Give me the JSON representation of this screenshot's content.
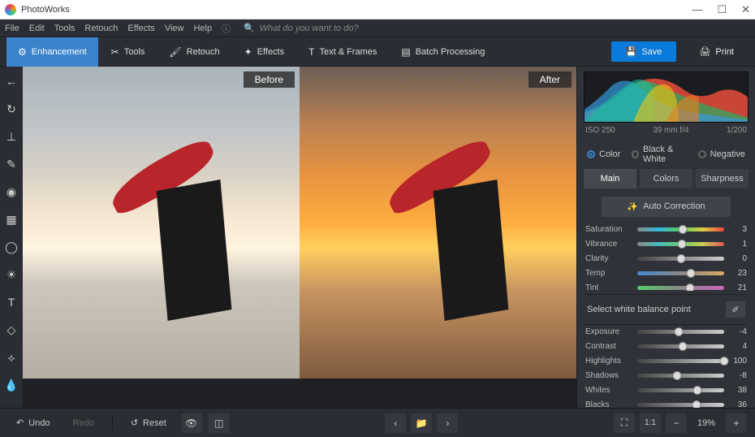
{
  "app": {
    "title": "PhotoWorks"
  },
  "window_controls": {
    "min": "—",
    "max": "☐",
    "close": "✕"
  },
  "menu": [
    "File",
    "Edit",
    "Tools",
    "Retouch",
    "Effects",
    "View",
    "Help"
  ],
  "search": {
    "placeholder": "What do you want to do?"
  },
  "tabs": [
    {
      "label": "Enhancement",
      "icon": "sliders-icon"
    },
    {
      "label": "Tools",
      "icon": "crop-icon"
    },
    {
      "label": "Retouch",
      "icon": "brush-icon"
    },
    {
      "label": "Effects",
      "icon": "wand-icon"
    },
    {
      "label": "Text & Frames",
      "icon": "text-icon"
    },
    {
      "label": "Batch Processing",
      "icon": "stack-icon"
    }
  ],
  "actions": {
    "save": "Save",
    "print": "Print"
  },
  "compare": {
    "before": "Before",
    "after": "After"
  },
  "histogram_meta": {
    "iso": "ISO 250",
    "lens": "39 mm f/4",
    "shutter": "1/200"
  },
  "color_modes": [
    "Color",
    "Black & White",
    "Negative"
  ],
  "subtabs": [
    "Main",
    "Colors",
    "Sharpness"
  ],
  "auto_correction": "Auto Correction",
  "sliders_top": [
    {
      "name": "Saturation",
      "value": 3,
      "pos": 52,
      "track": "sat"
    },
    {
      "name": "Vibrance",
      "value": 1,
      "pos": 51,
      "track": "vib"
    },
    {
      "name": "Clarity",
      "value": 0,
      "pos": 50,
      "track": "gray"
    },
    {
      "name": "Temp",
      "value": 23,
      "pos": 62,
      "track": "temp"
    },
    {
      "name": "Tint",
      "value": 21,
      "pos": 61,
      "track": "tint"
    }
  ],
  "white_balance_label": "Select white balance point",
  "sliders_bottom": [
    {
      "name": "Exposure",
      "value": -4,
      "pos": 48,
      "track": "gray"
    },
    {
      "name": "Contrast",
      "value": 4,
      "pos": 52,
      "track": "gray"
    },
    {
      "name": "Highlights",
      "value": 100,
      "pos": 100,
      "track": "gray"
    },
    {
      "name": "Shadows",
      "value": -8,
      "pos": 46,
      "track": "gray"
    },
    {
      "name": "Whites",
      "value": 38,
      "pos": 69,
      "track": "gray"
    },
    {
      "name": "Blacks",
      "value": 36,
      "pos": 68,
      "track": "gray"
    }
  ],
  "bottom": {
    "undo": "Undo",
    "redo": "Redo",
    "reset": "Reset",
    "zoom": "19%",
    "ratio": "1:1"
  }
}
